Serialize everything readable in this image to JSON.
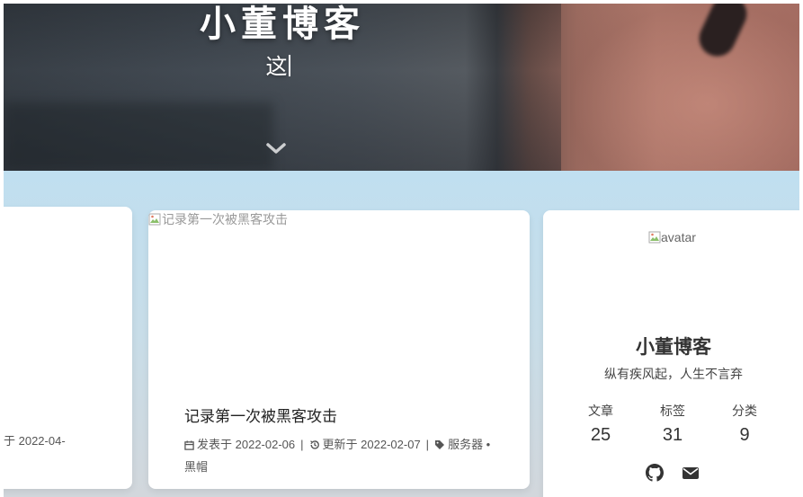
{
  "hero": {
    "site_title": "小董博客",
    "subtitle": "这"
  },
  "left_card": {
    "meta_fragment": "于 2022-04-"
  },
  "post": {
    "image_alt": "记录第一次被黑客攻击",
    "title": "记录第一次被黑客攻击",
    "published_label": "发表于",
    "published_date": "2022-02-06",
    "updated_label": "更新于",
    "updated_date": "2022-02-07",
    "tags": "服务器 • 黑帽"
  },
  "profile": {
    "avatar_alt": "avatar",
    "name": "小董博客",
    "description": "纵有疾风起，人生不言弃",
    "stats": [
      {
        "label": "文章",
        "value": "25"
      },
      {
        "label": "标签",
        "value": "31"
      },
      {
        "label": "分类",
        "value": "9"
      }
    ],
    "social_icons": [
      "github-icon",
      "email-icon"
    ]
  },
  "colors": {
    "content_background": "#c0dff0",
    "card_background": "#ffffff",
    "text_primary": "#333333"
  }
}
